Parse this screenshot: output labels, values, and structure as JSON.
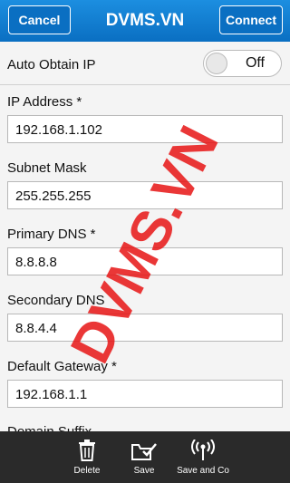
{
  "header": {
    "cancel_label": "Cancel",
    "title": "DVMS.VN",
    "connect_label": "Connect"
  },
  "auto_obtain": {
    "label": "Auto Obtain IP",
    "state": "Off"
  },
  "fields": [
    {
      "label": "IP Address *",
      "value": "192.168.1.102"
    },
    {
      "label": "Subnet Mask",
      "value": "255.255.255"
    },
    {
      "label": "Primary DNS *",
      "value": "8.8.8.8"
    },
    {
      "label": "Secondary DNS",
      "value": "8.8.4.4"
    },
    {
      "label": "Default Gateway *",
      "value": "192.168.1.1"
    },
    {
      "label": "Domain Suffix"
    }
  ],
  "watermark": "DVMS.VN",
  "toolbar": {
    "delete_label": "Delete",
    "save_label": "Save",
    "save_connect_label": "Save and Co"
  },
  "icons": {
    "delete": "trash-icon",
    "save": "save-folder-icon",
    "save_connect": "wifi-antenna-icon"
  },
  "colors": {
    "header": "#0a6fc2",
    "watermark": "#e61414",
    "toolbar": "#2a2a2a"
  }
}
